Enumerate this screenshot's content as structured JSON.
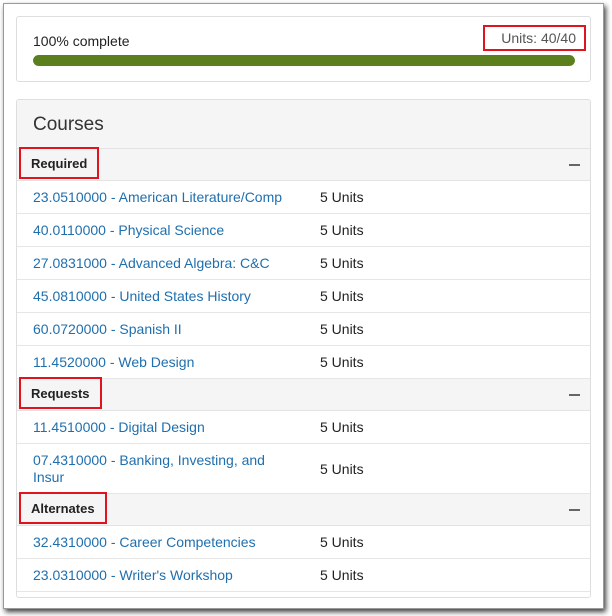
{
  "progress": {
    "label": "100% complete",
    "units_text": "Units: 40/40",
    "percent": 100,
    "fill_color": "#5b7f1d"
  },
  "courses": {
    "title": "Courses",
    "groups": [
      {
        "label": "Required",
        "items": [
          {
            "name": "23.0510000 - American Literature/Comp",
            "units": "5 Units"
          },
          {
            "name": "40.0110000 - Physical Science",
            "units": "5 Units"
          },
          {
            "name": "27.0831000 - Advanced Algebra: C&C",
            "units": "5 Units"
          },
          {
            "name": "45.0810000 - United States History",
            "units": "5 Units"
          },
          {
            "name": "60.0720000 - Spanish II",
            "units": "5 Units"
          },
          {
            "name": "11.4520000 - Web Design",
            "units": "5 Units"
          }
        ]
      },
      {
        "label": "Requests",
        "items": [
          {
            "name": "11.4510000 - Digital Design",
            "units": "5 Units"
          },
          {
            "name": "07.4310000 - Banking, Investing, and Insur",
            "units": "5 Units"
          }
        ]
      },
      {
        "label": "Alternates",
        "items": [
          {
            "name": "32.4310000 - Career Competencies",
            "units": "5 Units"
          },
          {
            "name": "23.0310000 - Writer's Workshop",
            "units": "5 Units"
          }
        ]
      }
    ]
  },
  "icons": {
    "collapse": "minus-icon"
  }
}
